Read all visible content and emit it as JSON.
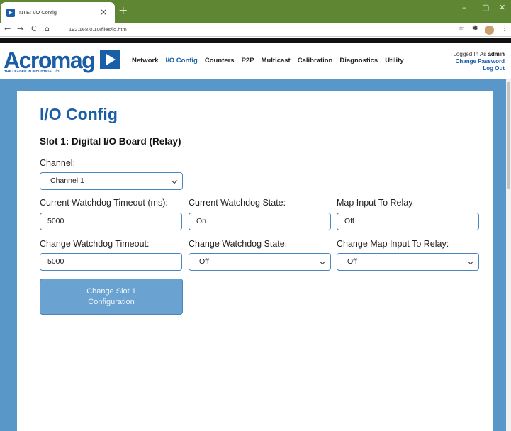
{
  "browser": {
    "tab_title": "NTE: I/O Config",
    "tab_close": "×",
    "new_tab": "+",
    "url": "192.168.0.10/files/io.htm",
    "window_controls": {
      "minimize": "–",
      "maximize": "▢",
      "close": "✕"
    },
    "nav": {
      "back": "←",
      "forward": "→",
      "reload": "C",
      "home": "⌂"
    },
    "toolbar_icons": {
      "star": "☆",
      "extensions": "✱",
      "menu": "⋮"
    }
  },
  "header": {
    "logo_text": "Acromag",
    "logo_tagline": "THE LEADER IN INDUSTRIAL I/O",
    "nav": [
      {
        "label": "Network",
        "active": false
      },
      {
        "label": "I/O Config",
        "active": true
      },
      {
        "label": "Counters",
        "active": false
      },
      {
        "label": "P2P",
        "active": false
      },
      {
        "label": "Multicast",
        "active": false
      },
      {
        "label": "Calibration",
        "active": false
      },
      {
        "label": "Diagnostics",
        "active": false
      },
      {
        "label": "Utility",
        "active": false
      }
    ],
    "user": {
      "logged_in_prefix": "Logged In As",
      "username": "admin",
      "change_password": "Change Password",
      "log_out": "Log Out"
    }
  },
  "main": {
    "title": "I/O Config",
    "slot_title": "Slot 1: Digital I/O Board (Relay)",
    "channel": {
      "label": "Channel:",
      "value": "Channel 1"
    },
    "current": {
      "watchdog_timeout_label": "Current Watchdog Timeout (ms):",
      "watchdog_timeout_value": "5000",
      "watchdog_state_label": "Current Watchdog State:",
      "watchdog_state_value": "On",
      "map_input_label": "Map Input To Relay",
      "map_input_value": "Off"
    },
    "change": {
      "watchdog_timeout_label": "Change Watchdog Timeout:",
      "watchdog_timeout_value": "5000",
      "watchdog_state_label": "Change Watchdog State:",
      "watchdog_state_value": "Off",
      "map_input_label": "Change Map Input To Relay:",
      "map_input_value": "Off"
    },
    "submit": {
      "line1": "Change Slot 1",
      "line2": "Configuration"
    }
  },
  "colors": {
    "accent": "#1a5ea8",
    "tab_bar": "#5f8632",
    "page_background": "#5a97c9",
    "button": "#6aa3d2"
  }
}
